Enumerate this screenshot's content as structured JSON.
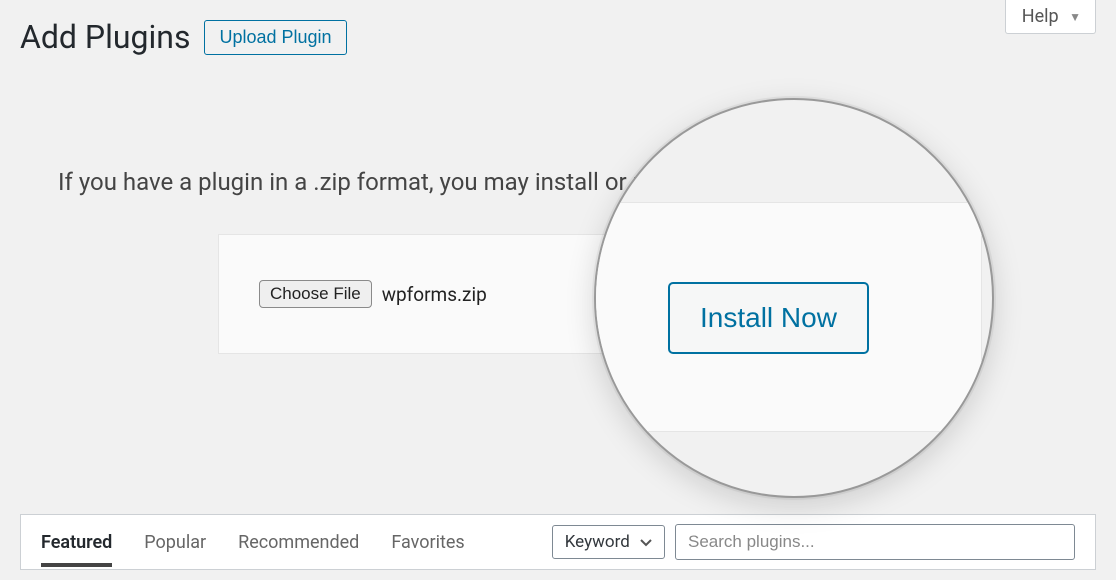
{
  "header": {
    "title": "Add Plugins",
    "upload_label": "Upload Plugin",
    "help_label": "Help"
  },
  "upload": {
    "instruction": "If you have a plugin in a .zip format, you may install or update it by uploading it here.",
    "choose_file_label": "Choose File",
    "selected_file": "wpforms.zip",
    "install_label": "Install Now"
  },
  "filter": {
    "tabs": [
      "Featured",
      "Popular",
      "Recommended",
      "Favorites"
    ],
    "active_tab": "Featured",
    "search_type": "Keyword",
    "search_placeholder": "Search plugins..."
  }
}
